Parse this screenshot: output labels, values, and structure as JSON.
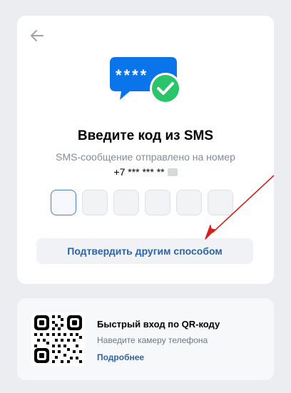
{
  "colors": {
    "page_bg": "#ebedf0",
    "card_bg": "#ffffff",
    "accent_blue": "#2d64a8",
    "bubble_blue": "#0a74ea",
    "check_green": "#2ac56a",
    "annotation_red": "#d9201c"
  },
  "header": {
    "back_icon": "arrow-left-icon"
  },
  "hero": {
    "icon": "sms-code-check-icon",
    "code_mask": "****"
  },
  "verify": {
    "title": "Введите код из SMS",
    "subtitle": "SMS-сообщение отправлено на номер",
    "phone": "+7 *** *** **",
    "code_length": 6,
    "alt_method_label": "Подтвердить другим способом"
  },
  "qr": {
    "title": "Быстрый вход по QR-коду",
    "subtitle": "Наведите камеру телефона",
    "link": "Подробнее"
  }
}
